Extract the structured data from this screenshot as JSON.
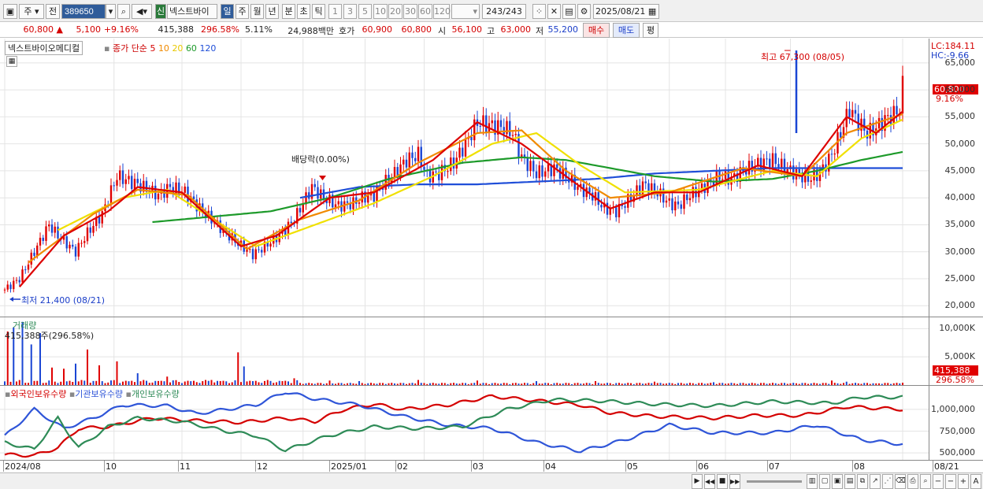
{
  "toolbar": {
    "period_main": "주",
    "prev_label": "전",
    "stock_code": "389650",
    "badge_new": "신",
    "stock_name_short": "넥스트바이",
    "periods": [
      "일",
      "주",
      "월",
      "년",
      "분",
      "초",
      "틱"
    ],
    "selected_period": "일",
    "intervals": [
      "1",
      "3",
      "5",
      "10",
      "20",
      "30",
      "60",
      "120"
    ],
    "count_current": "243",
    "count_total": "/243",
    "date": "2025/08/21"
  },
  "quote": {
    "price": "60,800",
    "arrow": "▲",
    "change": "5,100",
    "change_pct": "+9.16%",
    "volume": "415,388",
    "vol_ratio": "296.58%",
    "turnover": "5.11%",
    "amount": "24,988백만",
    "bid_label": "호가",
    "bid1": "60,900",
    "bid2": "60,800",
    "open_label": "시",
    "open": "56,100",
    "high_label": "고",
    "high": "63,000",
    "low_label": "저",
    "low": "55,200",
    "buy_btn": "매수",
    "sell_btn": "매도",
    "eval_btn": "평"
  },
  "main": {
    "stock_name": "넥스트바이오메디컬",
    "ma_label": "종가 단순",
    "ma_periods": [
      "5",
      "10",
      "20",
      "60",
      "120"
    ],
    "ma_colors": [
      "#dd0000",
      "#f08a00",
      "#f0e000",
      "#1d9a2a",
      "#1f4ed8"
    ],
    "lc": "LC:184.11",
    "hc": "HC:-9.66",
    "max_label": "최고 67,300 (08/05)",
    "min_label": "최저 21,400 (08/21)",
    "dividend_label": "배당락(0.00%)",
    "current_price_tag": "60,800",
    "current_pct_tag": "9.16%"
  },
  "volume_panel": {
    "title": "거래량",
    "value": "415,388주(296.58%)",
    "current_tag": "415,388",
    "current_pct_tag": "296.58%"
  },
  "holdings_panel": {
    "series": [
      "외국인보유수량",
      "기관보유수량",
      "개인보유수량"
    ],
    "colors": [
      "#d40000",
      "#2f55d8",
      "#2e8b57"
    ]
  },
  "chart_data": [
    {
      "type": "candlestick",
      "title": "넥스트바이오메디컬",
      "y_ticks": [
        65000,
        60000,
        55000,
        50000,
        45000,
        40000,
        35000,
        30000,
        25000,
        20000
      ],
      "ylim": [
        18000,
        69500
      ],
      "x_ticks": [
        "2024/08",
        "10",
        "11",
        "12",
        "2025/01",
        "02",
        "03",
        "04",
        "05",
        "06",
        "07",
        "08",
        "08/21"
      ],
      "close_path": [
        [
          0,
          23000
        ],
        [
          5,
          25000
        ],
        [
          10,
          30000
        ],
        [
          15,
          35000
        ],
        [
          18,
          33000
        ],
        [
          24,
          30000
        ],
        [
          28,
          33500
        ],
        [
          33,
          37000
        ],
        [
          38,
          44000
        ],
        [
          45,
          42500
        ],
        [
          52,
          40500
        ],
        [
          56,
          42000
        ],
        [
          61,
          41000
        ],
        [
          66,
          38000
        ],
        [
          72,
          35000
        ],
        [
          78,
          32000
        ],
        [
          84,
          29500
        ],
        [
          88,
          31000
        ],
        [
          94,
          33500
        ],
        [
          98,
          36000
        ],
        [
          101,
          39000
        ],
        [
          104,
          42000
        ],
        [
          108,
          40000
        ],
        [
          113,
          38500
        ],
        [
          118,
          39000
        ],
        [
          121,
          40000
        ],
        [
          125,
          40500
        ],
        [
          128,
          42500
        ],
        [
          132,
          44500
        ],
        [
          136,
          47000
        ],
        [
          140,
          48000
        ],
        [
          143,
          44000
        ],
        [
          147,
          44500
        ],
        [
          152,
          46500
        ],
        [
          156,
          50000
        ],
        [
          160,
          54000
        ],
        [
          164,
          53500
        ],
        [
          169,
          53000
        ],
        [
          172,
          52000
        ],
        [
          175,
          47500
        ],
        [
          180,
          44500
        ],
        [
          186,
          45500
        ],
        [
          190,
          44000
        ],
        [
          194,
          42000
        ],
        [
          199,
          40500
        ],
        [
          203,
          38000
        ],
        [
          207,
          37500
        ],
        [
          212,
          40000
        ],
        [
          216,
          42500
        ],
        [
          221,
          41000
        ],
        [
          225,
          39000
        ],
        [
          228,
          38500
        ],
        [
          232,
          40500
        ],
        [
          235,
          41500
        ],
        [
          238,
          42500
        ],
        [
          242,
          44000
        ],
        [
          246,
          43500
        ],
        [
          250,
          45000
        ],
        [
          256,
          46500
        ],
        [
          260,
          47000
        ],
        [
          264,
          45500
        ],
        [
          268,
          44500
        ],
        [
          272,
          43500
        ],
        [
          276,
          44500
        ],
        [
          280,
          48000
        ],
        [
          283,
          52000
        ],
        [
          286,
          56500
        ],
        [
          289,
          54000
        ],
        [
          292,
          52000
        ],
        [
          295,
          53000
        ],
        [
          298,
          54500
        ],
        [
          301,
          55500
        ],
        [
          303,
          56500
        ],
        [
          304,
          60800
        ]
      ],
      "ma5_path": [
        [
          5,
          23500
        ],
        [
          20,
          33000
        ],
        [
          35,
          37500
        ],
        [
          45,
          42000
        ],
        [
          60,
          41000
        ],
        [
          80,
          31000
        ],
        [
          92,
          33000
        ],
        [
          110,
          40000
        ],
        [
          125,
          41000
        ],
        [
          145,
          47000
        ],
        [
          160,
          54000
        ],
        [
          175,
          50000
        ],
        [
          190,
          44000
        ],
        [
          205,
          38000
        ],
        [
          220,
          41000
        ],
        [
          235,
          41000
        ],
        [
          255,
          46000
        ],
        [
          270,
          44000
        ],
        [
          285,
          55000
        ],
        [
          295,
          52000
        ],
        [
          304,
          56000
        ]
      ],
      "ma10_path": [
        [
          8,
          28000
        ],
        [
          30,
          37000
        ],
        [
          45,
          41500
        ],
        [
          62,
          40500
        ],
        [
          82,
          30500
        ],
        [
          100,
          36000
        ],
        [
          120,
          39500
        ],
        [
          140,
          46500
        ],
        [
          160,
          52000
        ],
        [
          175,
          52500
        ],
        [
          190,
          45000
        ],
        [
          205,
          40000
        ],
        [
          225,
          41000
        ],
        [
          250,
          45500
        ],
        [
          270,
          44000
        ],
        [
          285,
          52000
        ],
        [
          304,
          55500
        ]
      ],
      "ma20_path": [
        [
          18,
          34000
        ],
        [
          40,
          40000
        ],
        [
          55,
          41500
        ],
        [
          85,
          31000
        ],
        [
          105,
          35000
        ],
        [
          125,
          39000
        ],
        [
          145,
          44000
        ],
        [
          165,
          50000
        ],
        [
          180,
          52000
        ],
        [
          195,
          46000
        ],
        [
          210,
          41000
        ],
        [
          235,
          41500
        ],
        [
          260,
          45000
        ],
        [
          275,
          44000
        ],
        [
          290,
          51000
        ],
        [
          304,
          54500
        ]
      ],
      "ma60_path": [
        [
          50,
          35500
        ],
        [
          70,
          36500
        ],
        [
          90,
          37500
        ],
        [
          110,
          40000
        ],
        [
          130,
          43500
        ],
        [
          155,
          46500
        ],
        [
          175,
          47500
        ],
        [
          190,
          47000
        ],
        [
          205,
          45500
        ],
        [
          220,
          44000
        ],
        [
          240,
          43000
        ],
        [
          260,
          43500
        ],
        [
          275,
          45000
        ],
        [
          290,
          47000
        ],
        [
          304,
          48500
        ]
      ],
      "ma120_path": [
        [
          100,
          40000
        ],
        [
          120,
          42000
        ],
        [
          140,
          42500
        ],
        [
          160,
          42500
        ],
        [
          180,
          43000
        ],
        [
          200,
          43500
        ],
        [
          220,
          44500
        ],
        [
          240,
          45000
        ],
        [
          260,
          45500
        ],
        [
          280,
          45500
        ],
        [
          304,
          45500
        ]
      ],
      "max_point": {
        "date": "08/05",
        "value": 67300
      },
      "min_point": {
        "date": "08/21",
        "value": 21400
      }
    },
    {
      "type": "bar",
      "title": "거래량",
      "y_ticks": [
        "10,000K",
        "5,000K"
      ],
      "ylim": [
        0,
        12000
      ],
      "unit": "K",
      "spikes": [
        [
          1,
          9500
        ],
        [
          3,
          10200
        ],
        [
          6,
          11200
        ],
        [
          9,
          7200
        ],
        [
          12,
          9200
        ],
        [
          16,
          3100
        ],
        [
          20,
          2900
        ],
        [
          24,
          3800
        ],
        [
          28,
          6300
        ],
        [
          32,
          3500
        ],
        [
          38,
          4200
        ],
        [
          45,
          2100
        ],
        [
          55,
          1500
        ],
        [
          70,
          900
        ],
        [
          79,
          5800
        ],
        [
          81,
          3300
        ],
        [
          98,
          1200
        ],
        [
          110,
          800
        ],
        [
          120,
          700
        ],
        [
          140,
          900
        ],
        [
          160,
          800
        ],
        [
          180,
          700
        ],
        [
          200,
          700
        ],
        [
          220,
          600
        ],
        [
          240,
          500
        ],
        [
          260,
          400
        ],
        [
          280,
          800
        ],
        [
          285,
          600
        ],
        [
          295,
          300
        ],
        [
          304,
          415
        ]
      ]
    },
    {
      "type": "line",
      "title": "보유수량",
      "y_ticks": [
        "1,000,000",
        "750,000",
        "500,000"
      ],
      "ylim": [
        420000,
        1270000
      ],
      "series": [
        {
          "name": "외국인보유수량",
          "values": [
            [
              0,
              480000
            ],
            [
              10,
              470000
            ],
            [
              18,
              560000
            ],
            [
              25,
              780000
            ],
            [
              35,
              800000
            ],
            [
              50,
              900000
            ],
            [
              65,
              870000
            ],
            [
              80,
              850000
            ],
            [
              95,
              900000
            ],
            [
              105,
              860000
            ],
            [
              115,
              1000000
            ],
            [
              125,
              1060000
            ],
            [
              135,
              1000000
            ],
            [
              150,
              1050000
            ],
            [
              165,
              1150000
            ],
            [
              180,
              1100000
            ],
            [
              195,
              1050000
            ],
            [
              205,
              960000
            ],
            [
              220,
              920000
            ],
            [
              240,
              900000
            ],
            [
              255,
              930000
            ],
            [
              270,
              930000
            ],
            [
              285,
              1030000
            ],
            [
              304,
              1000000
            ]
          ]
        },
        {
          "name": "기관보유수량",
          "values": [
            [
              0,
              690000
            ],
            [
              10,
              1000000
            ],
            [
              20,
              780000
            ],
            [
              30,
              900000
            ],
            [
              40,
              1050000
            ],
            [
              55,
              1040000
            ],
            [
              65,
              950000
            ],
            [
              75,
              1000000
            ],
            [
              85,
              1050000
            ],
            [
              95,
              1200000
            ],
            [
              105,
              1120000
            ],
            [
              120,
              1050000
            ],
            [
              135,
              920000
            ],
            [
              150,
              820000
            ],
            [
              165,
              780000
            ],
            [
              180,
              620000
            ],
            [
              195,
              520000
            ],
            [
              210,
              650000
            ],
            [
              225,
              820000
            ],
            [
              240,
              730000
            ],
            [
              260,
              730000
            ],
            [
              275,
              820000
            ],
            [
              290,
              650000
            ],
            [
              304,
              600000
            ]
          ]
        },
        {
          "name": "개인보유수량",
          "values": [
            [
              0,
              620000
            ],
            [
              10,
              540000
            ],
            [
              18,
              900000
            ],
            [
              25,
              560000
            ],
            [
              35,
              800000
            ],
            [
              45,
              900000
            ],
            [
              60,
              860000
            ],
            [
              75,
              750000
            ],
            [
              85,
              700000
            ],
            [
              95,
              530000
            ],
            [
              110,
              700000
            ],
            [
              125,
              800000
            ],
            [
              140,
              780000
            ],
            [
              155,
              800000
            ],
            [
              170,
              1000000
            ],
            [
              185,
              1110000
            ],
            [
              200,
              1100000
            ],
            [
              220,
              1060000
            ],
            [
              240,
              1040000
            ],
            [
              260,
              1090000
            ],
            [
              280,
              1070000
            ],
            [
              290,
              1140000
            ],
            [
              304,
              1140000
            ]
          ]
        }
      ]
    }
  ]
}
